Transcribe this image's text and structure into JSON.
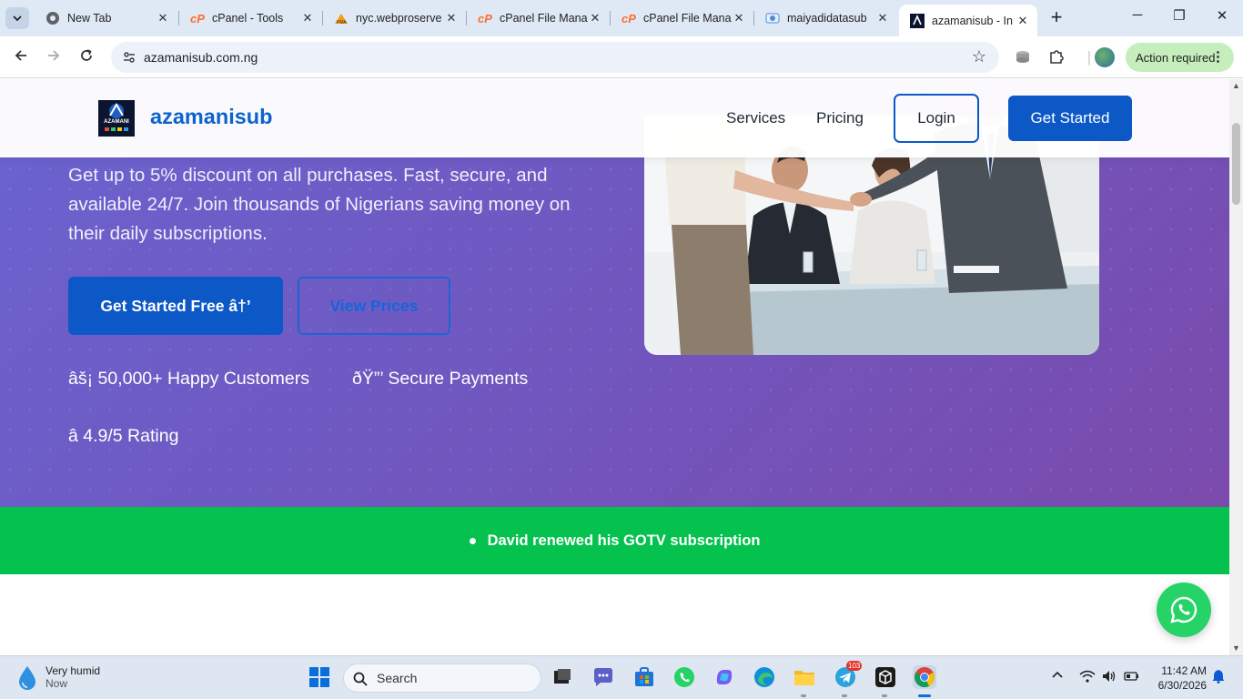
{
  "browser": {
    "tabs": [
      {
        "title": "New Tab",
        "favicon": "chrome-icon"
      },
      {
        "title": "cPanel - Tools",
        "favicon": "cpanel-icon"
      },
      {
        "title": "nyc.webproserve",
        "favicon": "phpmyadmin-icon"
      },
      {
        "title": "cPanel File Mana",
        "favicon": "cpanel-icon"
      },
      {
        "title": "cPanel File Mana",
        "favicon": "cpanel-icon"
      },
      {
        "title": "maiyadidatasub",
        "favicon": "site-icon"
      },
      {
        "title": "azamanisub - In",
        "favicon": "azamani-icon",
        "active": true
      }
    ],
    "url": "azamanisub.com.ng",
    "action_chip": "Action required"
  },
  "site": {
    "brand": "azamanisub",
    "logo_text": "AZAMANI",
    "nav": {
      "services": "Services",
      "pricing": "Pricing",
      "login": "Login",
      "get_started": "Get Started"
    },
    "hero": {
      "text": "Get up to 5% discount on all purchases. Fast, secure, and available 24/7. Join thousands of Nigerians saving money on their daily subscriptions.",
      "cta_primary": "Get Started Free  â†’",
      "cta_secondary": "View Prices",
      "stats": [
        "âš¡ 50,000+ Happy Customers",
        "ðŸ”’ Secure Payments",
        "â­ 4.9/5 Rating"
      ]
    },
    "ticker": "David renewed his GOTV subscription"
  },
  "taskbar": {
    "weather_title": "Very humid",
    "weather_sub": "Now",
    "search_placeholder": "Search",
    "telegram_badge": "103",
    "time": "11:42 AM",
    "date": "6/30/2026"
  },
  "colors": {
    "brand_blue": "#0c58c7",
    "hero_purple": "#6e5bc4",
    "ticker_green": "#05c24f",
    "whatsapp_green": "#25d366"
  }
}
